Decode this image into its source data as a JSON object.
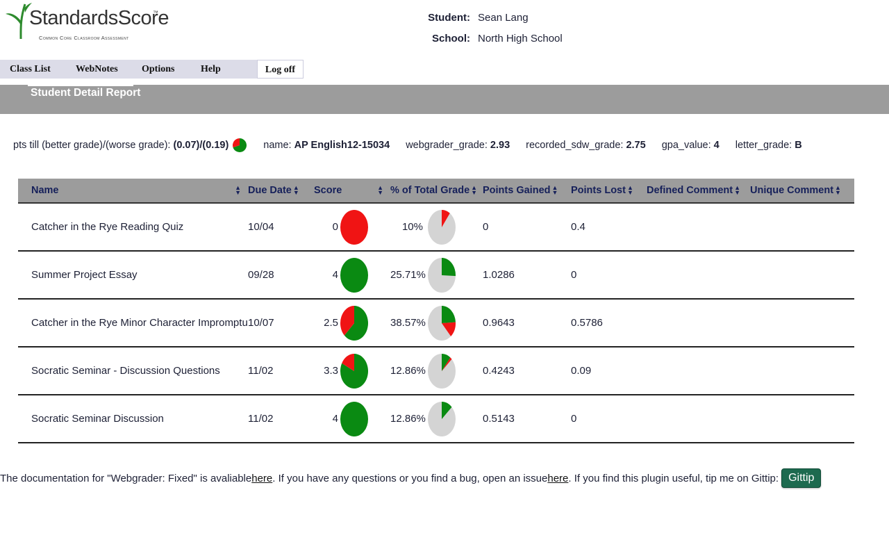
{
  "colors": {
    "green": "#0a8a12",
    "red": "#f01414",
    "grey_pie": "#d4d4d4",
    "banner": "#9c9c9c",
    "menu_bg": "#dcdce8",
    "gittip": "#1d6a4f"
  },
  "logo": {
    "name": "StandardsScore",
    "tm": "™",
    "tagline": "Common Core Classroom Assessment"
  },
  "student": {
    "student_label": "Student:",
    "student_name": "Sean Lang",
    "school_label": "School:",
    "school_name": "North High School"
  },
  "menu": {
    "class_list": "Class List",
    "webnotes": "WebNotes",
    "options": "Options",
    "help": "Help",
    "log_off": "Log off"
  },
  "banner": {
    "title": "Student Detail Report"
  },
  "summary": {
    "pts_label": "pts till (better grade)/(worse grade):",
    "pts_value": "(0.07)/(0.19)",
    "pts_pie_green_fraction": 0.7,
    "name_label": "name:",
    "name_value": "AP English12-15034",
    "webgrader_label": "webgrader_grade:",
    "webgrader_value": "2.93",
    "recorded_label": "recorded_sdw_grade:",
    "recorded_value": "2.75",
    "gpa_label": "gpa_value:",
    "gpa_value": "4",
    "letter_label": "letter_grade:",
    "letter_value": "B"
  },
  "table": {
    "headers": {
      "name": "Name",
      "due": "Due Date",
      "score": "Score",
      "pct": "% of Total Grade",
      "gained": "Points Gained",
      "lost": "Points Lost",
      "defined": "Defined Comment",
      "unique": "Unique Comment"
    },
    "rows": [
      {
        "name": "Catcher in the Rye Reading Quiz",
        "due": "10/04",
        "score": "0",
        "score_fraction": 0.0,
        "pct": "10%",
        "pct_fraction": 0.1,
        "gained": "0",
        "lost": "0.4",
        "defined": "",
        "unique": ""
      },
      {
        "name": "Summer Project Essay",
        "due": "09/28",
        "score": "4",
        "score_fraction": 1.0,
        "pct": "25.71%",
        "pct_fraction": 0.2571,
        "gained": "1.0286",
        "lost": "0",
        "defined": "",
        "unique": ""
      },
      {
        "name": "Catcher in the Rye Minor Character Impromptu",
        "due": "10/07",
        "score": "2.5",
        "score_fraction": 0.625,
        "pct": "38.57%",
        "pct_fraction": 0.3857,
        "gained": "0.9643",
        "lost": "0.5786",
        "defined": "",
        "unique": ""
      },
      {
        "name": "Socratic Seminar - Discussion Questions",
        "due": "11/02",
        "score": "3.3",
        "score_fraction": 0.825,
        "pct": "12.86%",
        "pct_fraction": 0.1286,
        "gained": "0.4243",
        "lost": "0.09",
        "defined": "",
        "unique": ""
      },
      {
        "name": "Socratic Seminar Discussion",
        "due": "11/02",
        "score": "4",
        "score_fraction": 1.0,
        "pct": "12.86%",
        "pct_fraction": 0.1286,
        "gained": "0.5143",
        "lost": "0",
        "defined": "",
        "unique": ""
      }
    ]
  },
  "footer": {
    "text1": "The documentation for \"Webgrader: Fixed\" is avaliable ",
    "link1": "here",
    "text2": ". If you have any questions or you find a bug, open an issue ",
    "link2": "here",
    "text3": ". If you find this plugin useful, tip me on Gittip:",
    "button": "Gittip"
  }
}
